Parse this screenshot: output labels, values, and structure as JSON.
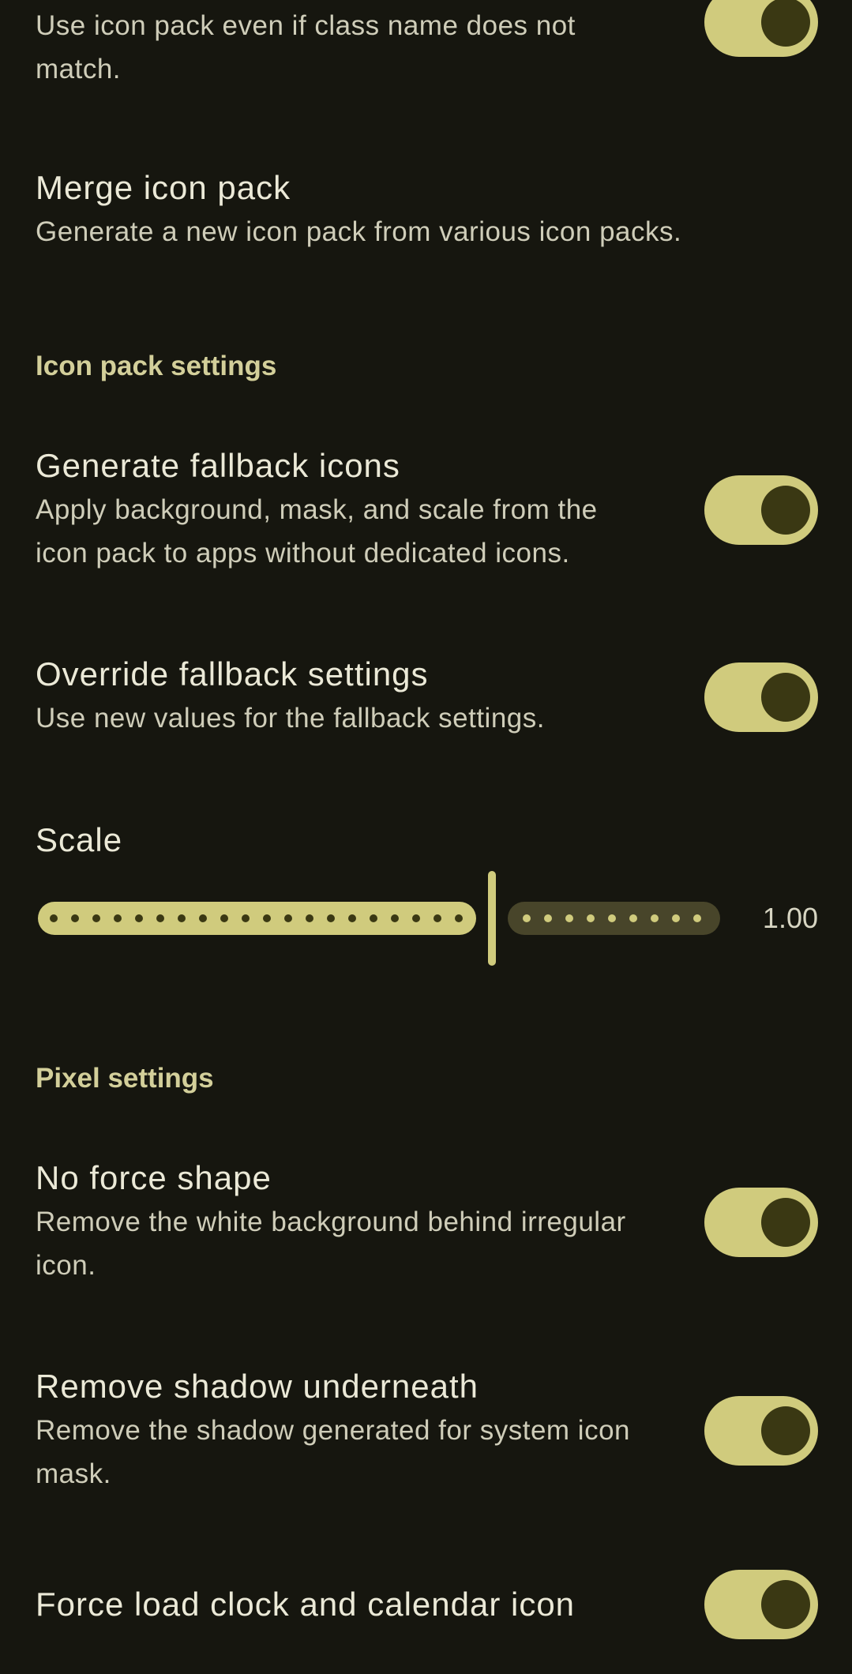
{
  "prefs": {
    "icon_pack_strict": {
      "summary": "Use icon pack even if class name does not match.",
      "enabled": true
    },
    "merge_icon_pack": {
      "title": "Merge icon pack",
      "summary": "Generate a new icon pack from various icon packs."
    },
    "section_icon_pack": "Icon pack settings",
    "generate_fallback": {
      "title": "Generate fallback icons",
      "summary": "Apply background, mask, and scale from the icon pack to apps without dedicated icons.",
      "enabled": true
    },
    "override_fallback": {
      "title": "Override fallback settings",
      "summary": "Use new values for the fallback settings.",
      "enabled": true
    },
    "scale": {
      "title": "Scale",
      "value_label": "1.00",
      "fraction": 0.68
    },
    "section_pixel": "Pixel settings",
    "no_force_shape": {
      "title": "No force shape",
      "summary": "Remove the white background behind irregular icon.",
      "enabled": true
    },
    "remove_shadow": {
      "title": "Remove shadow underneath",
      "summary": "Remove the shadow generated for system icon mask.",
      "enabled": true
    },
    "force_clock_calendar": {
      "title": "Force load clock and calendar icon",
      "enabled": true
    }
  },
  "colors": {
    "background": "#16160f",
    "accent": "#d0cb7d",
    "thumb": "#3a3813",
    "inactive_track": "#48452a"
  }
}
